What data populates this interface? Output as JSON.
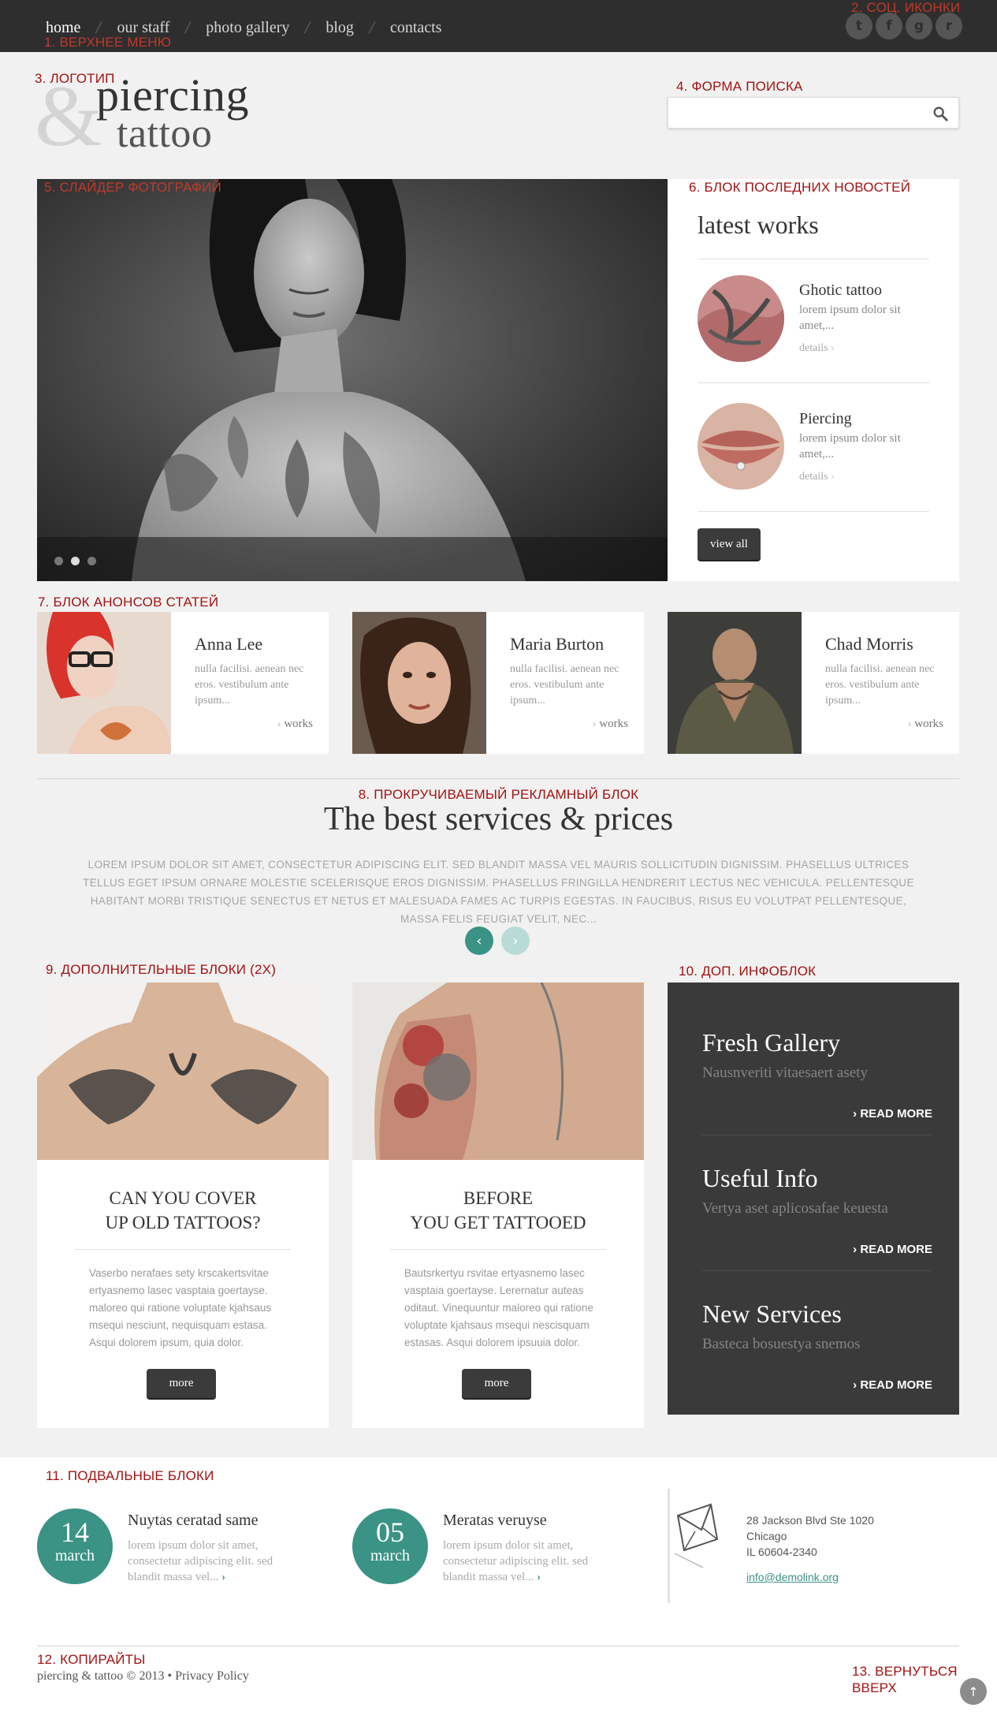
{
  "nav": {
    "items": [
      "home",
      "our staff",
      "photo gallery",
      "blog",
      "contacts"
    ],
    "active": "home",
    "separator": "/"
  },
  "social": {
    "icons": [
      "twitter-icon",
      "facebook-icon",
      "google-plus-icon",
      "rss-icon"
    ],
    "glyphs": [
      "t",
      "f",
      "g",
      "r"
    ]
  },
  "logo": {
    "amp": "&",
    "line1": "piercing",
    "line2": "tattoo"
  },
  "search": {
    "placeholder": "",
    "value": ""
  },
  "slider": {
    "slide_count": 3,
    "active_slide": 2
  },
  "latest": {
    "title": "latest works",
    "items": [
      {
        "title": "Ghotic tattoo",
        "text": "lorem ipsum dolor sit amet,...",
        "link": "details"
      },
      {
        "title": "Piercing",
        "text": "lorem ipsum dolor sit amet,...",
        "link": "details"
      }
    ],
    "button": "view all"
  },
  "articles": [
    {
      "name": "Anna Lee",
      "text": "nulla facilisi. aenean nec eros. vestibulum ante ipsum...",
      "link": "works"
    },
    {
      "name": "Maria Burton",
      "text": "nulla facilisi. aenean nec eros. vestibulum ante ipsum...",
      "link": "works"
    },
    {
      "name": "Chad Morris",
      "text": "nulla facilisi. aenean nec eros. vestibulum ante ipsum...",
      "link": "works"
    }
  ],
  "promo": {
    "title": "The best services & prices",
    "text": "LOREM IPSUM DOLOR SIT AMET, CONSECTETUR ADIPISCING ELIT. SED BLANDIT MASSA VEL MAURIS SOLLICITUDIN DIGNISSIM. PHASELLUS ULTRICES TELLUS EGET IPSUM ORNARE MOLESTIE SCELERISQUE EROS DIGNISSIM. PHASELLUS FRINGILLA HENDRERIT LECTUS NEC VEHICULA. PELLENTESQUE HABITANT MORBI TRISTIQUE SENECTUS ET NETUS ET MALESUADA FAMES AC TURPIS EGESTAS. IN FAUCIBUS, RISUS EU VOLUTPAT PELLENTESQUE, MASSA FELIS FEUGIAT VELIT, NEC...",
    "prev": "‹",
    "next": "›"
  },
  "info_blocks": [
    {
      "title_l1": "CAN YOU COVER",
      "title_l2": "UP OLD TATTOOS?",
      "text": "Vaserbo nerafaes sety krscakertsvitae ertyasnemo lasec vasptaia goertayse. maloreo qui ratione voluptate kjahsaus msequi nesciunt, nequisquam estasa. Asqui dolorem ipsum, quia dolor.",
      "button": "more"
    },
    {
      "title_l1": "BEFORE",
      "title_l2": "YOU GET TATTOOED",
      "text": "Bautsrkertyu rsvitae ertyasnemo lasec vasptaia goertayse. Lerernatur auteas oditaut. Vinequuntur maloreo qui ratione voluptate kjahsaus msequi nescisquam estasas. Asqui dolorem ipsuuia dolor.",
      "button": "more"
    }
  ],
  "dark_block": [
    {
      "title": "Fresh Gallery",
      "sub": "Nausnveriti vitaesaert asety",
      "link": "READ MORE"
    },
    {
      "title": "Useful Info",
      "sub": "Vertya aset aplicosafae keuesta",
      "link": "READ MORE"
    },
    {
      "title": "New Services",
      "sub": "Basteca bosuestya snemos",
      "link": "READ MORE"
    }
  ],
  "footer": {
    "news": [
      {
        "day": "14",
        "month": "march",
        "title": "Nuytas ceratad same",
        "text": "lorem ipsum dolor sit amet, consectetur adipiscing elit. sed blandit massa vel...",
        "arrow": "›"
      },
      {
        "day": "05",
        "month": "march",
        "title": "Meratas veruyse",
        "text": "lorem ipsum dolor sit amet, consectetur adipiscing elit. sed blandit massa vel...",
        "arrow": "›"
      }
    ],
    "address": {
      "line1": "28 Jackson Blvd Ste 1020",
      "line2": "Chicago",
      "line3": "IL 60604-2340",
      "email": "info@demolink.org"
    },
    "copyright": "piercing & tattoo © 2013 • Privacy Policy",
    "to_top": "↑"
  },
  "annotations": {
    "a1": "1. ВЕРХНЕЕ МЕНЮ",
    "a2": "2. СОЦ. ИКОНКИ",
    "a3": "3. ЛОГОТИП",
    "a4": "4. ФОРМА ПОИСКА",
    "a5": "5. СЛАЙДЕР ФОТОГРАФИЙ",
    "a6": "6. БЛОК ПОСЛЕДНИХ НОВОСТЕЙ",
    "a7": "7. БЛОК АНОНСОВ СТАТЕЙ",
    "a8": "8. ПРОКРУЧИВАЕМЫЙ РЕКЛАМНЫЙ БЛОК",
    "a9": "9. ДОПОЛНИТЕЛЬНЫЕ БЛОКИ (2Х)",
    "a10": "10. ДОП. ИНФОБЛОК",
    "a11": "11. ПОДВАЛЬНЫЕ БЛОКИ",
    "a12": "12. КОПИРАЙТЫ",
    "a13_l1": "13. ВЕРНУТЬСЯ",
    "a13_l2": "ВВЕРХ"
  },
  "colors": {
    "accent": "#3a9384",
    "dark_bar": "#2e2e2e",
    "annotation": "#a31212"
  }
}
